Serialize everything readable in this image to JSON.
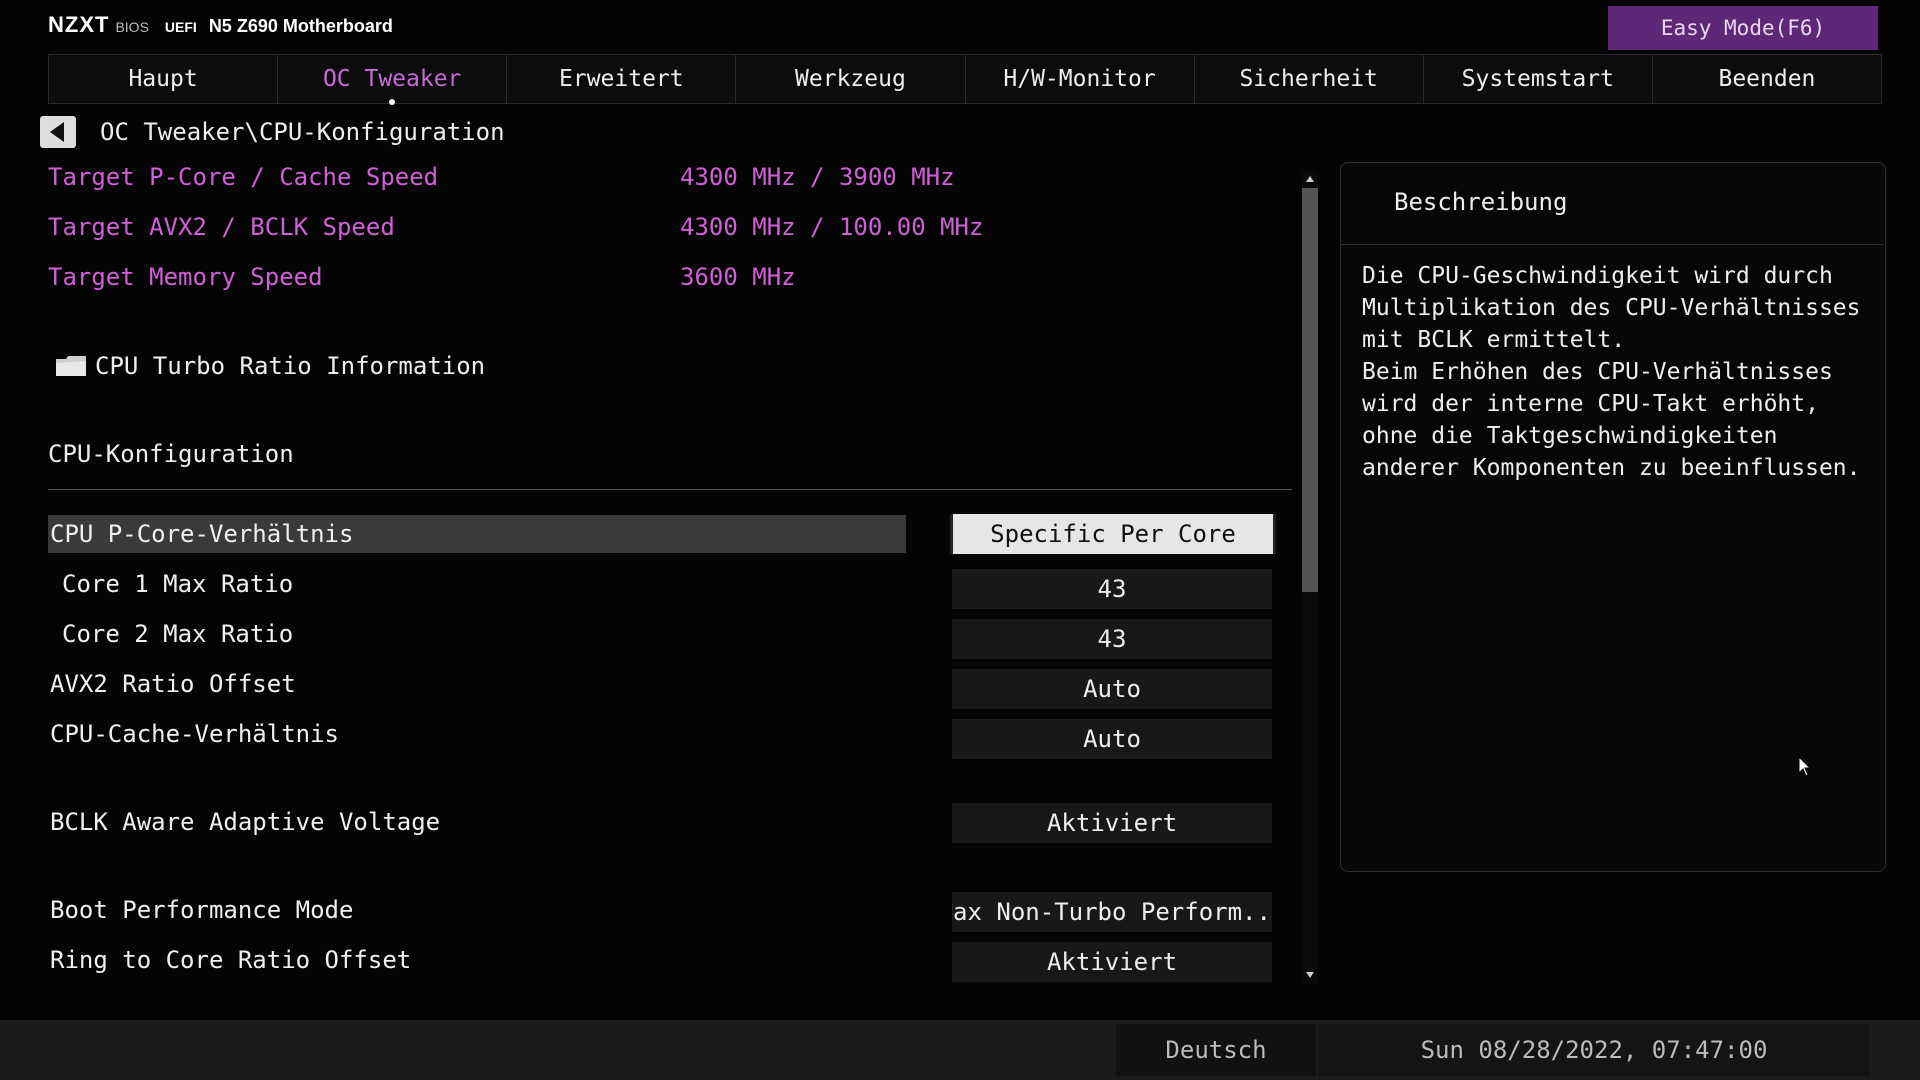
{
  "header": {
    "brand": "NZXT",
    "bios_tag": "BIOS",
    "uefi_tag": "UEFI",
    "model": "N5 Z690 Motherboard",
    "easy_mode_label": "Easy Mode(F6)",
    "accent_color": "#5f2778"
  },
  "tabs": [
    {
      "label": "Haupt"
    },
    {
      "label": "OC Tweaker",
      "active": true
    },
    {
      "label": "Erweitert"
    },
    {
      "label": "Werkzeug"
    },
    {
      "label": "H/W-Monitor"
    },
    {
      "label": "Sicherheit"
    },
    {
      "label": "Systemstart"
    },
    {
      "label": "Beenden"
    }
  ],
  "breadcrumb": {
    "back_icon": "back-arrow-icon",
    "path": "OC Tweaker\\CPU-Konfiguration"
  },
  "info": [
    {
      "label": "Target P-Core / Cache Speed",
      "value": "4300 MHz / 3900 MHz"
    },
    {
      "label": "Target AVX2 / BCLK Speed",
      "value": "4300 MHz / 100.00 MHz"
    },
    {
      "label": "Target Memory Speed",
      "value": "3600 MHz"
    }
  ],
  "info_color": "#d15fd8",
  "folder": {
    "icon": "folder-icon",
    "label": "CPU Turbo Ratio Information"
  },
  "section_title": "CPU-Konfiguration",
  "settings": [
    {
      "label": "CPU P-Core-Verhältnis",
      "value": "Specific Per Core",
      "selected": true
    },
    {
      "label": "Core 1 Max Ratio",
      "value": "43",
      "indent": true
    },
    {
      "label": "Core 2 Max Ratio",
      "value": "43",
      "indent": true
    },
    {
      "label": "AVX2 Ratio Offset",
      "value": "Auto"
    },
    {
      "label": "CPU-Cache-Verhältnis",
      "value": "Auto"
    },
    {
      "label": "BCLK Aware Adaptive Voltage",
      "value": "Aktiviert"
    },
    {
      "label": "Boot Performance Mode",
      "value": "Max Non-Turbo Perform..."
    },
    {
      "label": "Ring to Core Ratio Offset",
      "value": "Aktiviert"
    }
  ],
  "description": {
    "title": "Beschreibung",
    "text": "Die CPU-Geschwindigkeit wird durch\nMultiplikation des CPU-Verhältnisses\nmit BCLK ermittelt.\nBeim Erhöhen des CPU-Verhältnisses\nwird der interne CPU-Takt erhöht,\nohne die Taktgeschwindigkeiten\nanderer Komponenten zu beeinflussen."
  },
  "footer": {
    "language": "Deutsch",
    "datetime": "Sun 08/28/2022, 07:47:00"
  }
}
